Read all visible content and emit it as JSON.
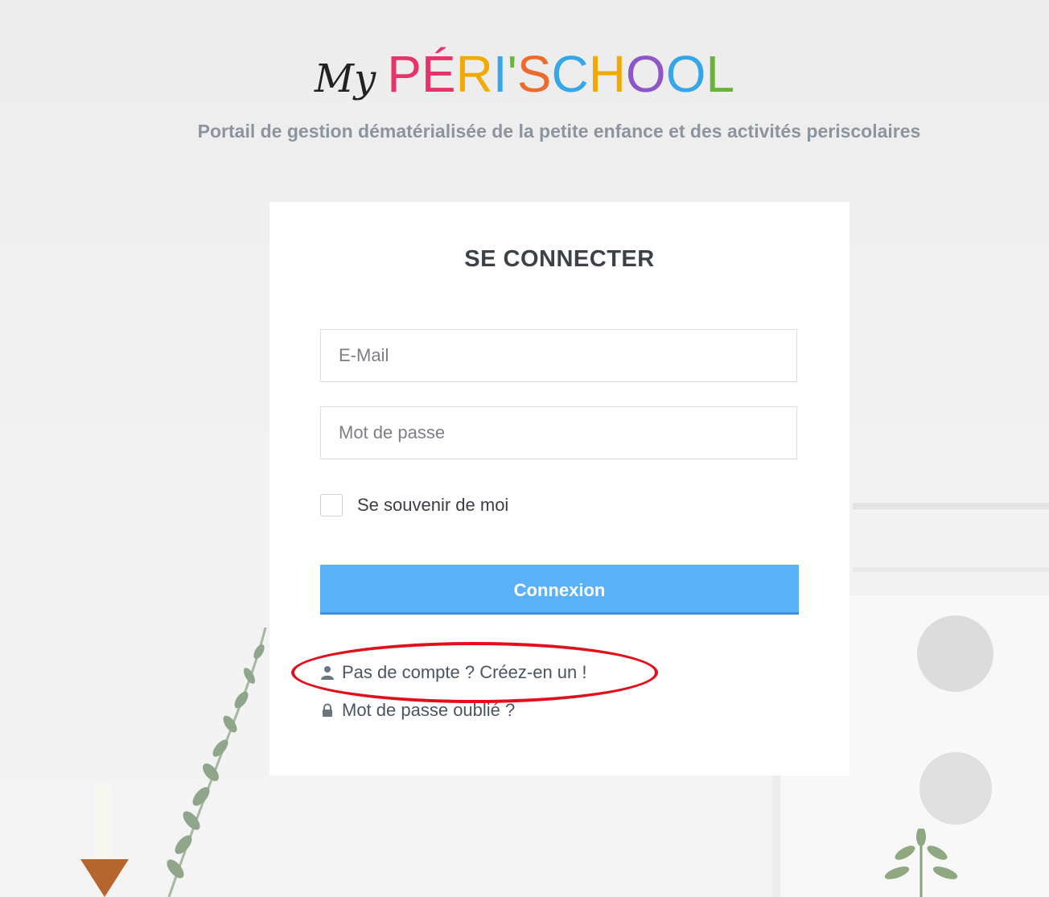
{
  "logo": {
    "prefix": "My",
    "letters": [
      {
        "char": "P",
        "color": "#e8336a"
      },
      {
        "char": "É",
        "color": "#e8336a"
      },
      {
        "char": "R",
        "color": "#f2a900"
      },
      {
        "char": "I",
        "color": "#35a7e8"
      },
      {
        "char": "'",
        "color": "#6ab33f"
      },
      {
        "char": "S",
        "color": "#ec6b2d"
      },
      {
        "char": "C",
        "color": "#35a7e8"
      },
      {
        "char": "H",
        "color": "#f2a900"
      },
      {
        "char": "O",
        "color": "#8d57c9"
      },
      {
        "char": "O",
        "color": "#35a7e8"
      },
      {
        "char": "L",
        "color": "#6ab33f"
      }
    ]
  },
  "tagline": "Portail de gestion dématérialisée de la petite enfance et des activités periscolaires",
  "login": {
    "title": "SE CONNECTER",
    "email_placeholder": "E-Mail",
    "password_placeholder": "Mot de passe",
    "remember_label": "Se souvenir de moi",
    "remember_checked": false,
    "submit_label": "Connexion",
    "create_account_label": "Pas de compte ? Créez-en un !",
    "create_account_icon": "user-icon",
    "forgot_password_label": "Mot de passe oublié ?",
    "forgot_password_icon": "lock-icon"
  },
  "colors": {
    "accent": "#5ab1f8",
    "annotation": "#e0111a"
  }
}
